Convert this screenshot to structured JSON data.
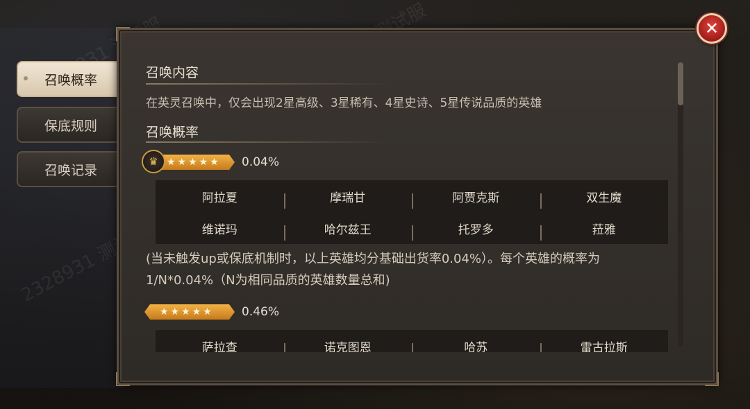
{
  "tabs": [
    {
      "label": "召唤概率",
      "active": true
    },
    {
      "label": "保底规则",
      "active": false
    },
    {
      "label": "召唤记录",
      "active": false
    }
  ],
  "close": {
    "icon": "close-icon",
    "glyph": "✕"
  },
  "section1": {
    "title": "召唤内容",
    "description": "在英灵召唤中，仅会出现2星高级、3星稀有、4星史诗、5星传说品质的英雄"
  },
  "section2": {
    "title": "召唤概率"
  },
  "tier1": {
    "stars": "★★★★★",
    "percent": "0.04%",
    "heroes": [
      [
        "阿拉夏",
        "摩瑞甘",
        "阿贾克斯",
        "双生魔"
      ],
      [
        "维诺玛",
        "哈尔兹王",
        "托罗多",
        "菈雅"
      ]
    ],
    "note": "(当未触发up或保底机制时，以上英雄均分基础出货率0.04%）。每个英雄的概率为1/N*0.04%（N为相同品质的英雄数量总和)"
  },
  "tier2": {
    "stars": "★★★★★",
    "percent": "0.46%",
    "heroes": [
      [
        "萨拉查",
        "诺克图恩",
        "哈苏",
        "雷古拉斯"
      ]
    ]
  },
  "watermark": {
    "id": "2328931",
    "text": "测试服"
  },
  "colors": {
    "accent_gold": "#f2b246",
    "close_red": "#d0342c",
    "active_tab": "#efe3cf"
  }
}
